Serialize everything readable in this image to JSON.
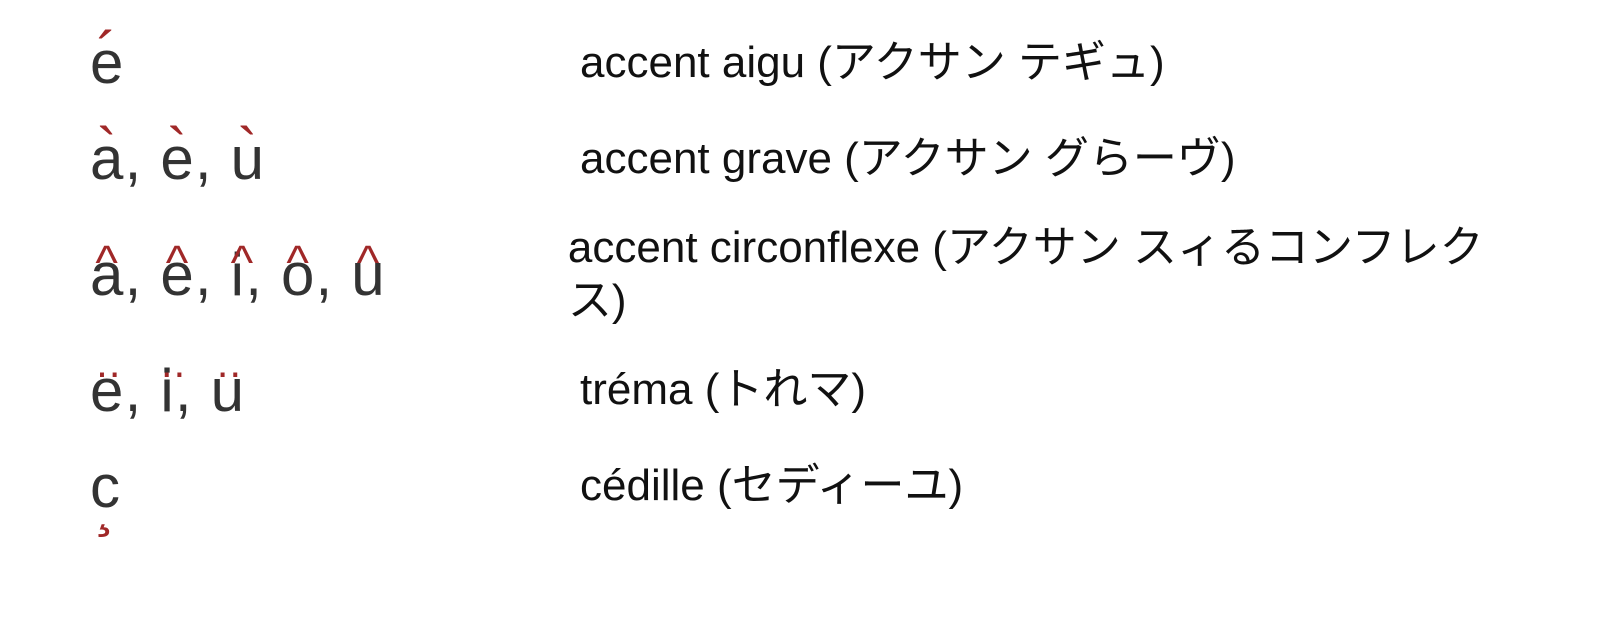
{
  "rows": [
    {
      "chars": [
        {
          "base": "e",
          "accent": "´",
          "accentClass": "aigu"
        }
      ],
      "desc": "accent aigu (アクサン  テギュ)"
    },
    {
      "chars": [
        {
          "base": "a",
          "accent": "`",
          "accentClass": "grave",
          "comma": true
        },
        {
          "base": "e",
          "accent": "`",
          "accentClass": "grave",
          "comma": true
        },
        {
          "base": "u",
          "accent": "`",
          "accentClass": "grave"
        }
      ],
      "desc": "accent grave (アクサン  グらーヴ)"
    },
    {
      "chars": [
        {
          "base": "a",
          "accent": "^",
          "accentClass": "circ",
          "comma": true
        },
        {
          "base": "e",
          "accent": "^",
          "accentClass": "circ",
          "comma": true
        },
        {
          "base": "i",
          "accent": "^",
          "accentClass": "circ",
          "comma": true
        },
        {
          "base": "o",
          "accent": "^",
          "accentClass": "circ",
          "comma": true
        },
        {
          "base": "u",
          "accent": "^",
          "accentClass": "circ"
        }
      ],
      "desc": "accent circonflexe (アクサン  スィるコンフレクス)"
    },
    {
      "chars": [
        {
          "base": "e",
          "accent": "‥",
          "accentClass": "trema",
          "comma": true
        },
        {
          "base": "i",
          "accent": "‥",
          "accentClass": "trema",
          "comma": true
        },
        {
          "base": "u",
          "accent": "‥",
          "accentClass": "trema"
        }
      ],
      "desc": "tréma (トれマ)"
    },
    {
      "chars": [
        {
          "base": "c",
          "cedilla": "¸"
        }
      ],
      "desc": "cédille (セディーユ)"
    }
  ],
  "separator": ",  "
}
